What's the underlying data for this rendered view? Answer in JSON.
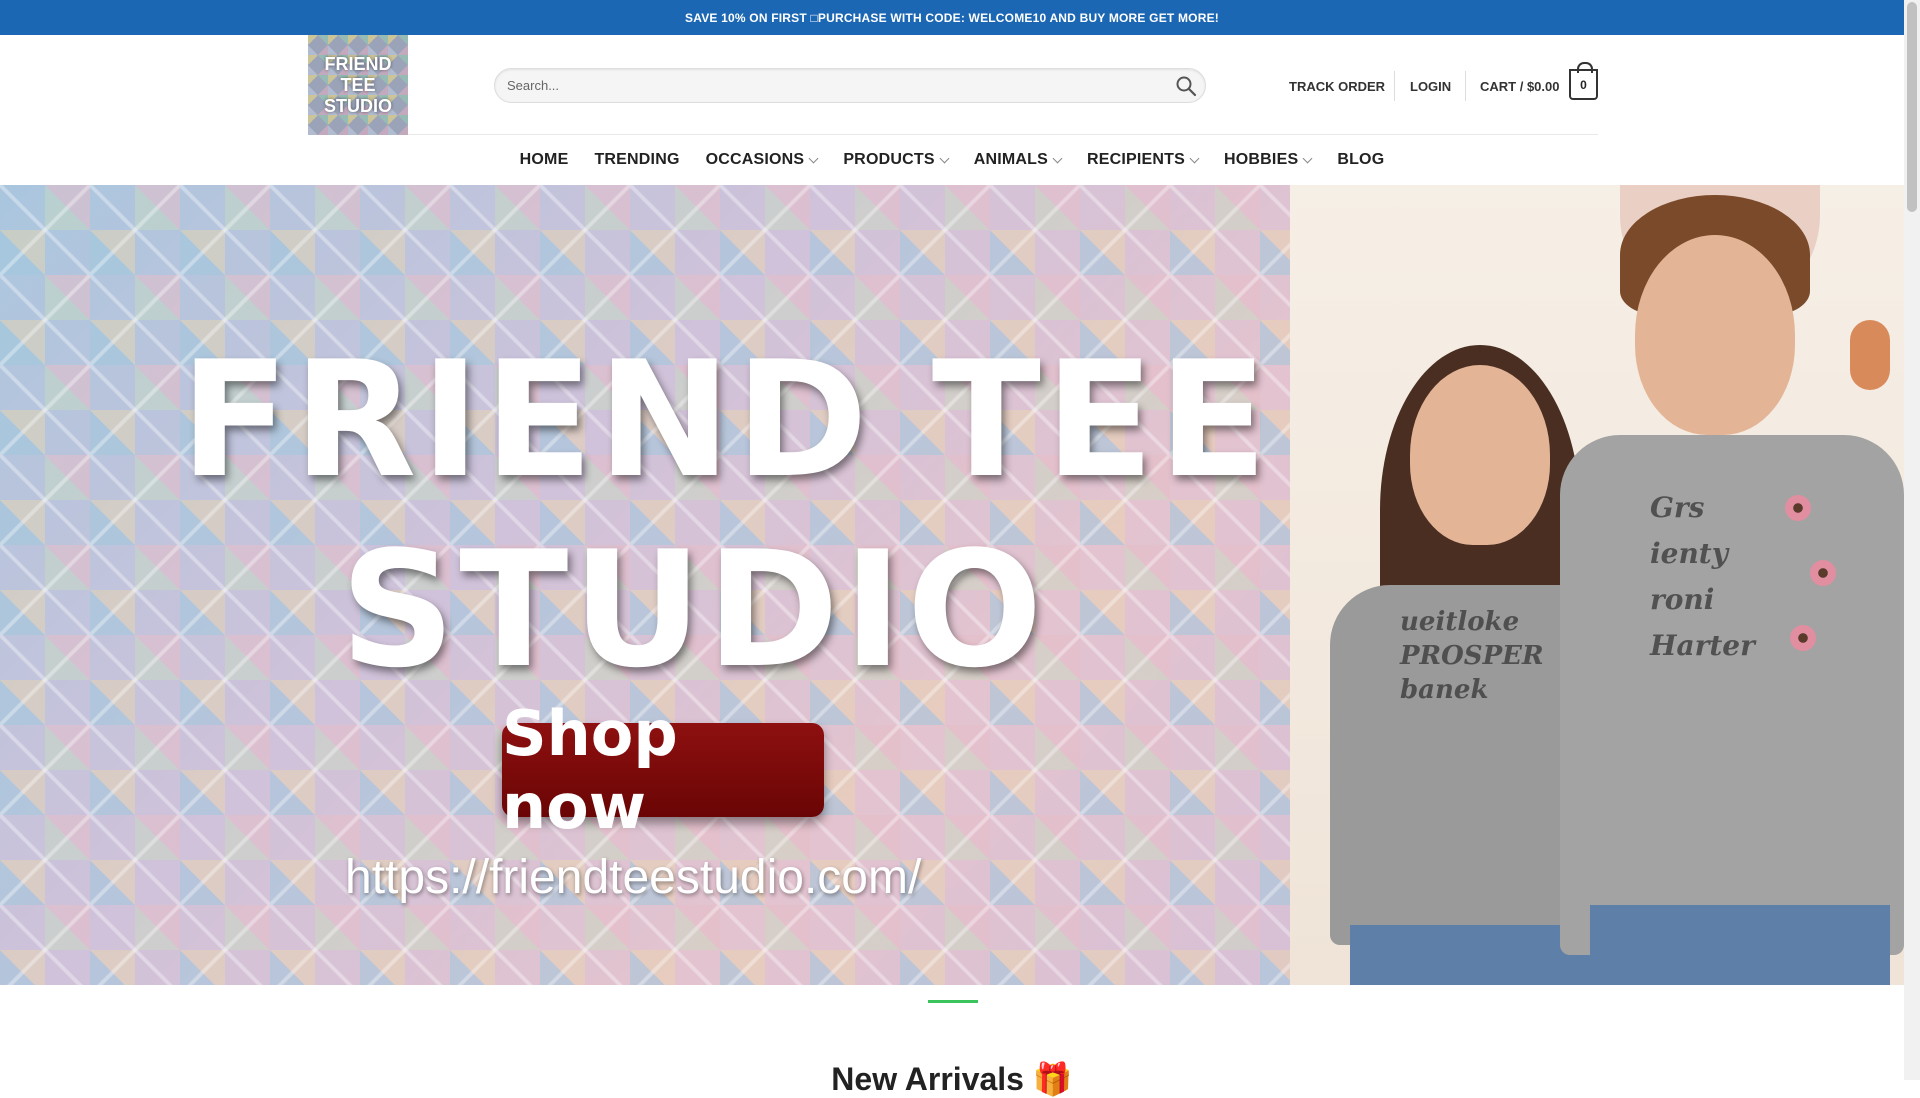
{
  "promo": {
    "text": "SAVE 10% ON FIRST □PURCHASE WITH CODE: WELCOME10 AND BUY MORE GET MORE!"
  },
  "logo": {
    "line1": "FRIEND",
    "line2": "TEE",
    "line3": "STUDIO"
  },
  "search": {
    "placeholder": "Search...",
    "icon": "search-icon"
  },
  "account": {
    "track_order": "TRACK ORDER",
    "login": "LOGIN",
    "cart_label": "CART / $0.00",
    "cart_count": "0"
  },
  "nav": {
    "items": [
      {
        "label": "HOME"
      },
      {
        "label": "TRENDING"
      },
      {
        "label": "OCCASIONS"
      },
      {
        "label": "PRODUCTS"
      },
      {
        "label": "ANIMALS"
      },
      {
        "label": "RECIPIENTS"
      },
      {
        "label": "HOBBIES"
      },
      {
        "label": "BLOG"
      }
    ]
  },
  "hero": {
    "title_line1": "FRIEND TEE",
    "title_line2": "STUDIO",
    "button": "Shop now",
    "url": "https://friendteestudio.com/",
    "shirt_text_left": "ueitloke\nPROSPER\nbanek",
    "shirt_text_right": "Grs\nienty\nroni\nHarter"
  },
  "section": {
    "title": "New Arrivals 🎁"
  },
  "colors": {
    "promo_bg": "#1c67b3",
    "button_bg": "#7a0a0a",
    "divider": "#3cc45c"
  }
}
